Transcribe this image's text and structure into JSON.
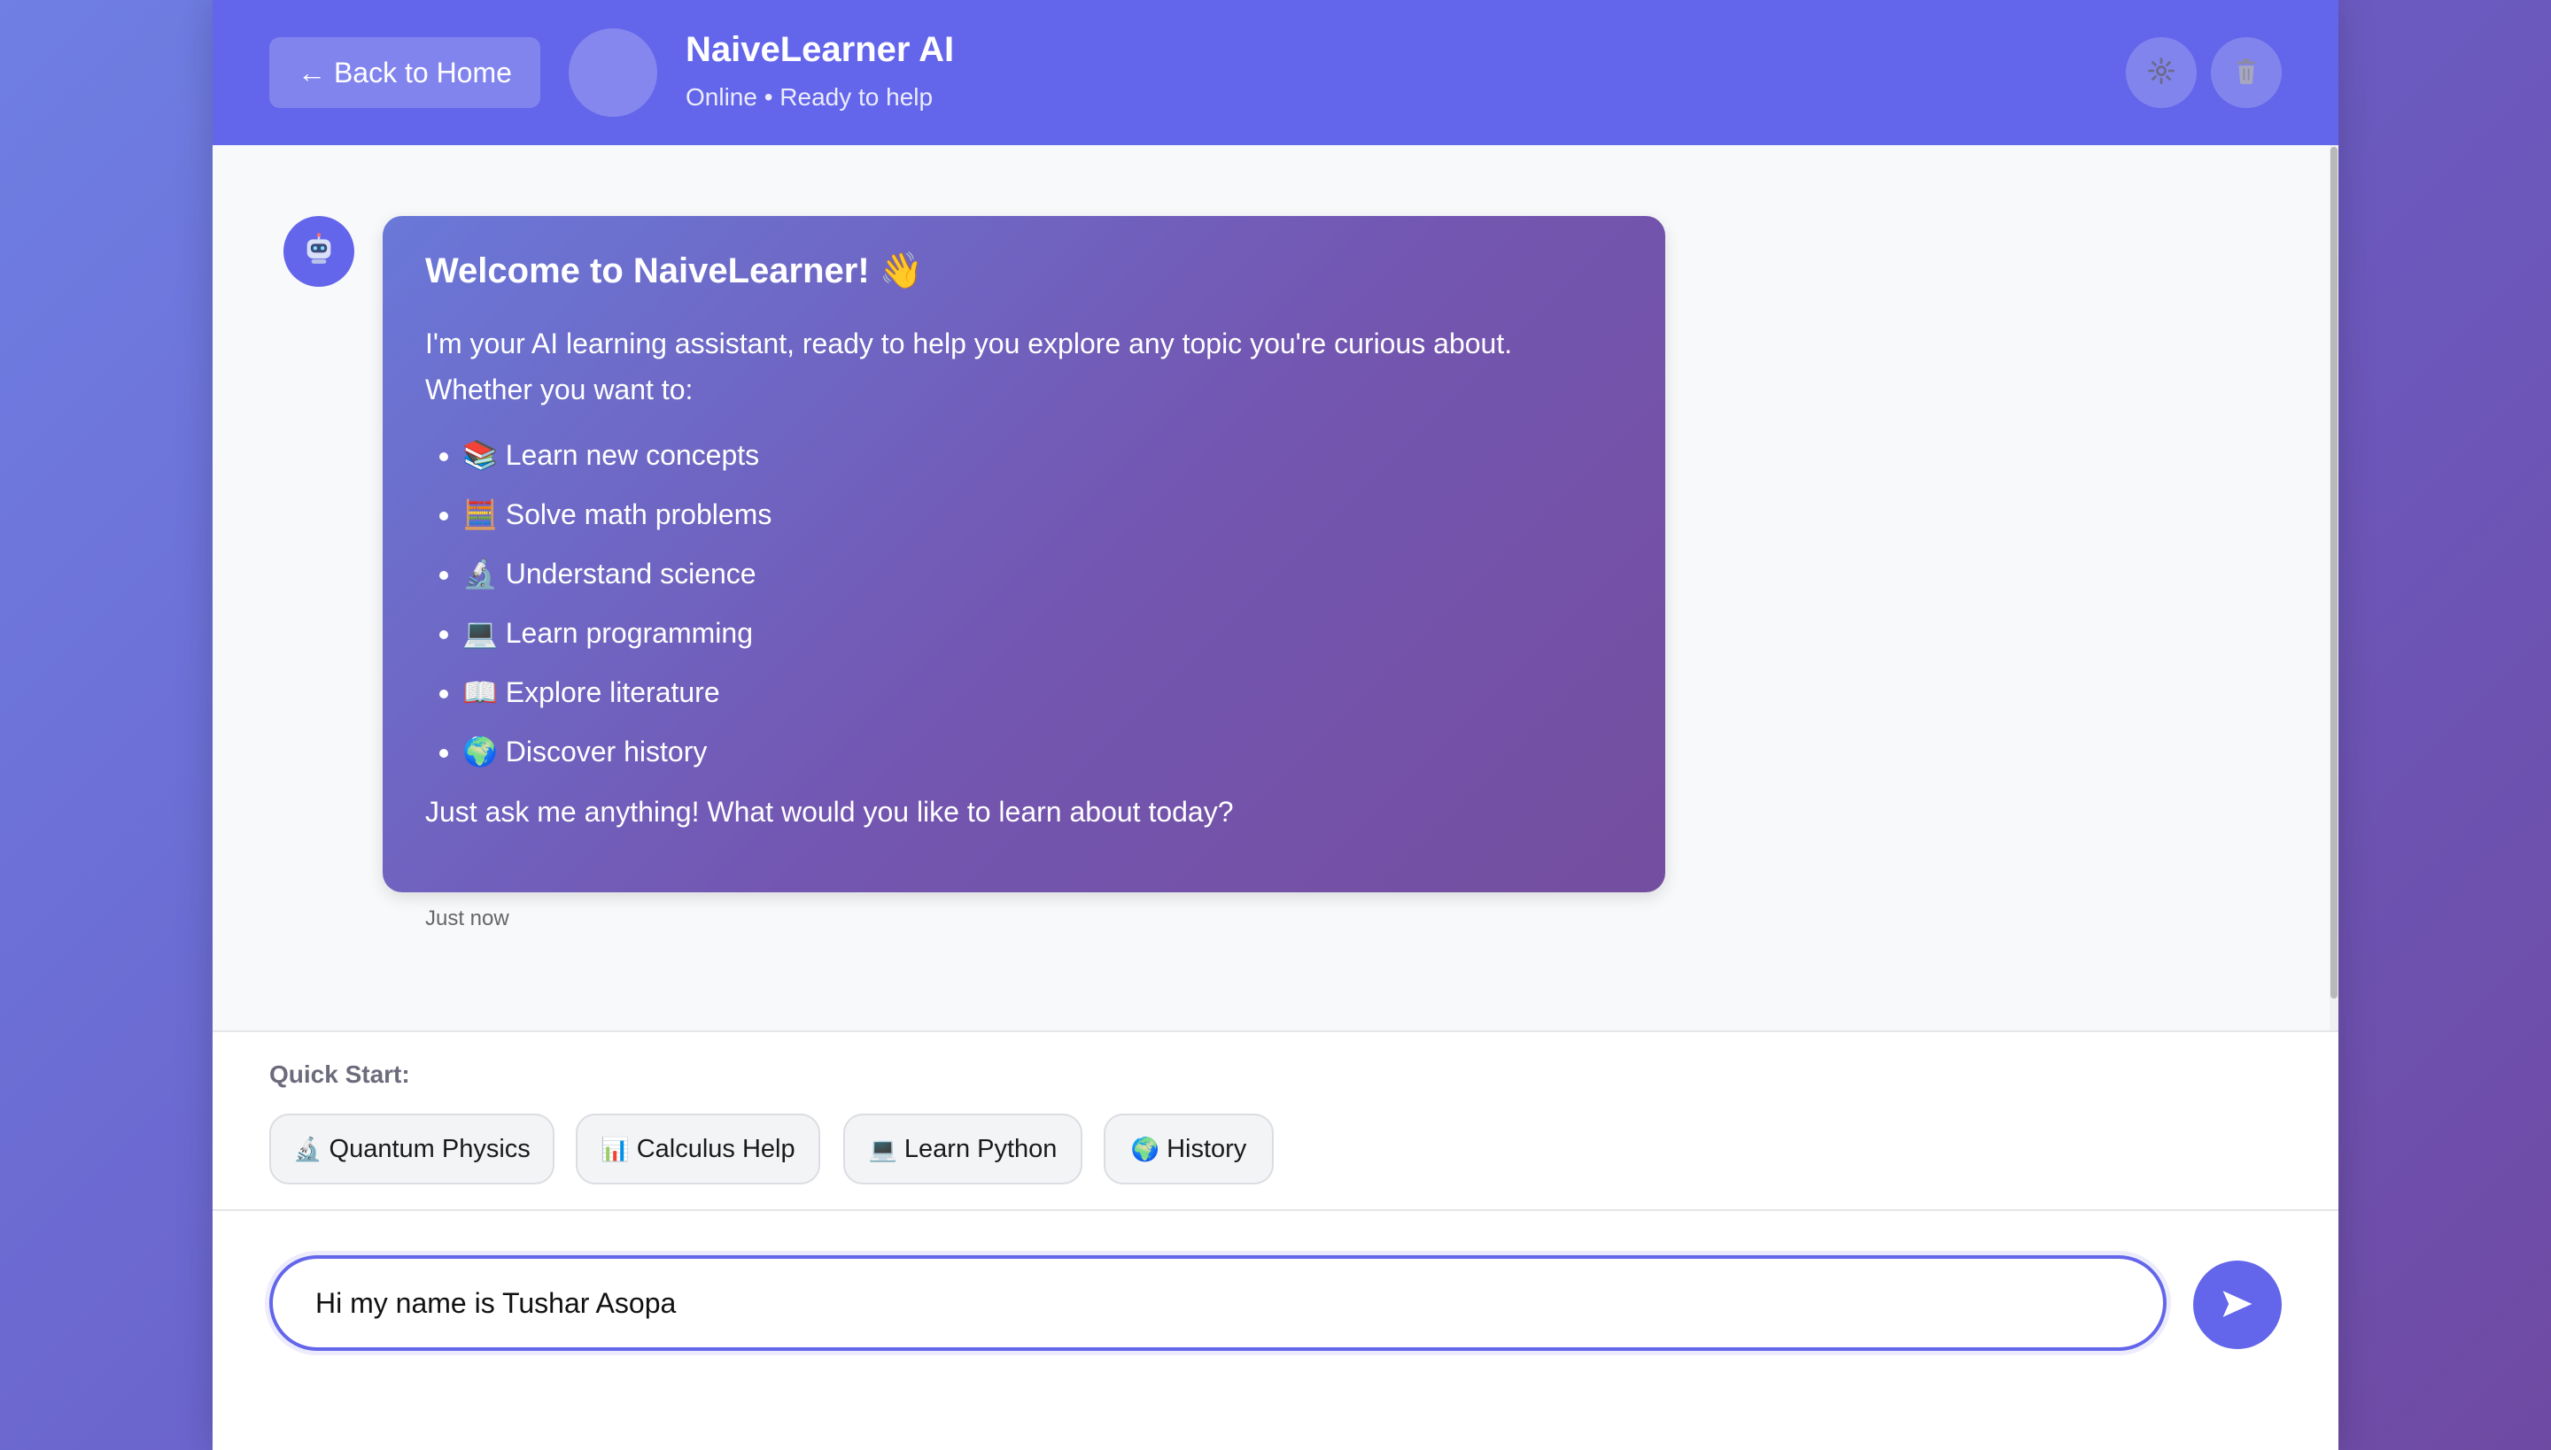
{
  "header": {
    "back_label": "← Back to Home",
    "title": "NaiveLearner AI",
    "status": "Online • Ready to help",
    "settings_icon": "⚙",
    "trash_icon": "🗑"
  },
  "chat": {
    "bot_avatar_icon": "🤖",
    "welcome": {
      "heading": "Welcome to NaiveLearner! 👋",
      "intro": "I'm your AI learning assistant, ready to help you explore any topic you're curious about. Whether you want to:",
      "items": [
        {
          "icon": "📚",
          "label": "Learn new concepts"
        },
        {
          "icon": "🧮",
          "label": "Solve math problems"
        },
        {
          "icon": "🔬",
          "label": "Understand science"
        },
        {
          "icon": "💻",
          "label": "Learn programming"
        },
        {
          "icon": "📖",
          "label": "Explore literature"
        },
        {
          "icon": "🌍",
          "label": "Discover history"
        }
      ],
      "closing": "Just ask me anything! What would you like to learn about today?"
    },
    "timestamp": "Just now"
  },
  "quick_start": {
    "label": "Quick Start:",
    "chips": [
      {
        "icon": "🔬",
        "label": "Quantum Physics"
      },
      {
        "icon": "📊",
        "label": "Calculus Help"
      },
      {
        "icon": "💻",
        "label": "Learn Python"
      },
      {
        "icon": "🌍",
        "label": "History"
      }
    ]
  },
  "input": {
    "value": "Hi my name is Tushar Asopa",
    "send_icon": "➤"
  },
  "colors": {
    "accent": "#6366ea",
    "bubble_start": "#6a78d8",
    "bubble_end": "#744e9f"
  }
}
